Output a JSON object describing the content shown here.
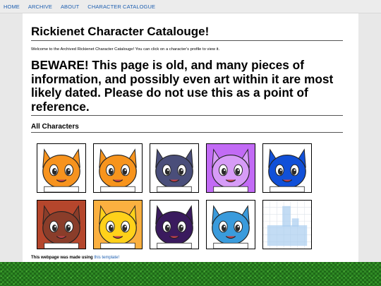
{
  "nav": {
    "items": [
      "HOME",
      "ARCHIVE",
      "ABOUT",
      "CHARACTER CATALOGUE"
    ]
  },
  "main": {
    "title": "Rickienet Character Catalouge!",
    "intro": "Welcome to the Archived Rickienet Character Catalouge! You can click on a character's profile to view it.",
    "warning": "BEWARE! This page is old, and many pieces of information, and possibly even art within it are most likely dated. Please do not use this as a point of reference.",
    "section_heading": "All Characters"
  },
  "footer": {
    "text": "This webpage was made using ",
    "link": "this template!"
  },
  "characters": [
    {
      "icon": "orange-fox-character-portrait",
      "bg": "#ffffff",
      "fur": "#f7931e"
    },
    {
      "icon": "orange-bow-character-portrait",
      "bg": "#ffffff",
      "fur": "#f7941d"
    },
    {
      "icon": "navy-collar-character-portrait",
      "bg": "#ffffff",
      "fur": "#4a4e7a"
    },
    {
      "icon": "purple-pink-character-portrait",
      "bg": "#c26bf5",
      "fur": "#d79cf7"
    },
    {
      "icon": "blue-shadow-character-portrait",
      "bg": "#ffffff",
      "fur": "#1150d8"
    },
    {
      "icon": "brown-d-character-portrait",
      "bg": "#b5462c",
      "fur": "#8a3d2a"
    },
    {
      "icon": "yellow-character-portrait",
      "bg": "#fbb040",
      "fur": "#ffd11a"
    },
    {
      "icon": "dark-purple-character-portrait",
      "bg": "#ffffff",
      "fur": "#3a1a5e"
    },
    {
      "icon": "light-blue-character-portrait",
      "bg": "#ffffff",
      "fur": "#3a9bdc"
    },
    {
      "icon": "placeholder-grid-portrait",
      "bg": "#ffffff",
      "fur": "#a9cdf0"
    }
  ]
}
